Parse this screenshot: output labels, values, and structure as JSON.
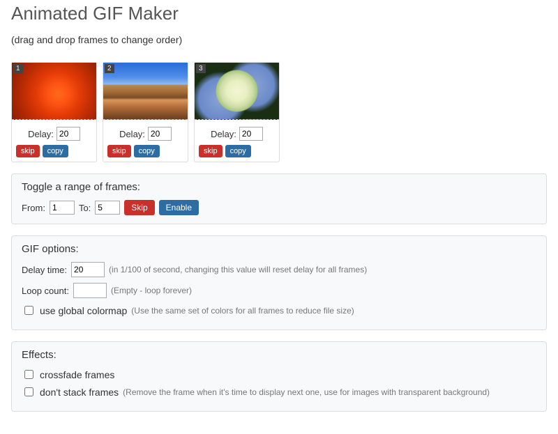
{
  "header": {
    "title": "Animated GIF Maker",
    "subtitle": "(drag and drop frames to change order)"
  },
  "frames": [
    {
      "index": "1",
      "delay_label": "Delay:",
      "delay_value": "20",
      "skip": "skip",
      "copy": "copy",
      "thumb": "flower"
    },
    {
      "index": "2",
      "delay_label": "Delay:",
      "delay_value": "20",
      "skip": "skip",
      "copy": "copy",
      "thumb": "canyon"
    },
    {
      "index": "3",
      "delay_label": "Delay:",
      "delay_value": "20",
      "skip": "skip",
      "copy": "copy",
      "thumb": "hydrangea"
    }
  ],
  "toggle_range": {
    "title": "Toggle a range of frames:",
    "from_label": "From:",
    "from_value": "1",
    "to_label": "To:",
    "to_value": "5",
    "skip": "Skip",
    "enable": "Enable"
  },
  "gif_options": {
    "title": "GIF options:",
    "delay_label": "Delay time:",
    "delay_value": "20",
    "delay_hint": "(in 1/100 of second, changing this value will reset delay for all frames)",
    "loop_label": "Loop count:",
    "loop_value": "",
    "loop_hint": "(Empty - loop forever)",
    "global_colormap_checked": false,
    "global_colormap_label": "use global colormap",
    "global_colormap_hint": "(Use the same set of colors for all frames to reduce file size)"
  },
  "effects": {
    "title": "Effects:",
    "crossfade_checked": false,
    "crossfade_label": "crossfade frames",
    "dont_stack_checked": false,
    "dont_stack_label": "don't stack frames",
    "dont_stack_hint": "(Remove the frame when it's time to display next one, use for images with transparent background)"
  }
}
